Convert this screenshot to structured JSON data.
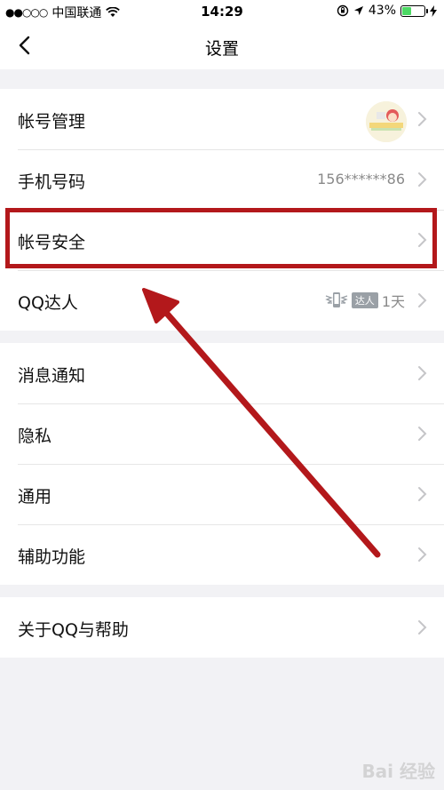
{
  "status_bar": {
    "signal_dots": "●●○○○",
    "carrier": "中国联通",
    "time": "14:29",
    "battery_percent": "43%",
    "battery_color": "#4cd964"
  },
  "nav": {
    "title": "设置",
    "back_icon": "chevron-left-icon"
  },
  "groups": {
    "account": [
      {
        "label": "帐号管理"
      },
      {
        "label": "手机号码",
        "value": "156******86"
      },
      {
        "label": "帐号安全"
      },
      {
        "label": "QQ达人",
        "badge": "达人",
        "value": "1天"
      }
    ],
    "general": [
      {
        "label": "消息通知"
      },
      {
        "label": "隐私"
      },
      {
        "label": "通用"
      },
      {
        "label": "辅助功能"
      }
    ],
    "about": [
      {
        "label": "关于QQ与帮助"
      }
    ]
  },
  "annotation": {
    "highlight_color": "#b3181b",
    "arrow_color": "#b3181b",
    "highlighted_item": "帐号安全"
  },
  "watermark": "Bai 经验"
}
